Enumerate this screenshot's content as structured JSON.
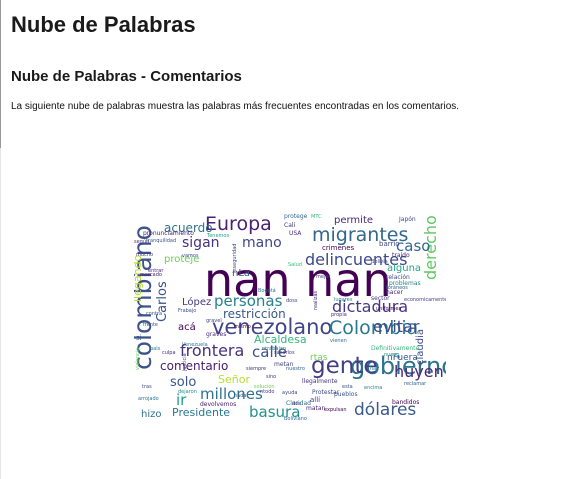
{
  "page": {
    "title": "Nube de Palabras",
    "section_title": "Nube de Palabras - Comentarios",
    "description": "La siguiente nube de palabras muestra las palabras más frecuentes encontradas en los comentarios."
  },
  "wordcloud": {
    "words": [
      {
        "text": "nan nan",
        "color": "#440154"
      },
      {
        "text": "colombiano",
        "color": "#3b528b"
      },
      {
        "text": "gobierno",
        "color": "#2c728e"
      },
      {
        "text": "venezolano",
        "color": "#414487"
      },
      {
        "text": "gente",
        "color": "#433e85"
      },
      {
        "text": "Europa",
        "color": "#482173"
      },
      {
        "text": "migrantes",
        "color": "#31688e"
      },
      {
        "text": "Colombia",
        "color": "#2a788e"
      },
      {
        "text": "delincuentes",
        "color": "#3e4989"
      },
      {
        "text": "frontera",
        "color": "#46327e"
      },
      {
        "text": "dictadura",
        "color": "#443983"
      },
      {
        "text": "derecho",
        "color": "#5ec962"
      },
      {
        "text": "dólares",
        "color": "#38598c"
      },
      {
        "text": "personas",
        "color": "#26828e"
      },
      {
        "text": "huyen",
        "color": "#482878"
      },
      {
        "text": "calle",
        "color": "#3b528b"
      },
      {
        "text": "millones",
        "color": "#2c728e"
      },
      {
        "text": "basura",
        "color": "#21918c"
      },
      {
        "text": "evitar",
        "color": "#3e4989"
      },
      {
        "text": "caso",
        "color": "#31688e"
      },
      {
        "text": "sigan",
        "color": "#46327e"
      },
      {
        "text": "mano",
        "color": "#404688"
      },
      {
        "text": "comentario",
        "color": "#481a6c"
      },
      {
        "text": "solo",
        "color": "#39568c"
      },
      {
        "text": "Presidente",
        "color": "#2a788e"
      },
      {
        "text": "restricción",
        "color": "#38598c"
      },
      {
        "text": "Carlos",
        "color": "#3b528b"
      },
      {
        "text": "acuerdo",
        "color": "#2c728e"
      },
      {
        "text": "llegando",
        "color": "#b5de2b"
      },
      {
        "text": "Señor",
        "color": "#b5de2b"
      },
      {
        "text": "Alcaldesa",
        "color": "#35b779"
      },
      {
        "text": "permite",
        "color": "#482878"
      },
      {
        "text": "alguna",
        "color": "#21a685"
      },
      {
        "text": "claudia",
        "color": "#3e4989"
      },
      {
        "text": "López",
        "color": "#453781"
      },
      {
        "text": "proteje",
        "color": "#6ece58"
      },
      {
        "text": "ir",
        "color": "#1f9e89"
      },
      {
        "text": "hizo",
        "color": "#2c728e"
      },
      {
        "text": "acá",
        "color": "#440154"
      },
      {
        "text": "nLa",
        "color": "#39568c"
      },
      {
        "text": "nFuera",
        "color": "#39568c"
      },
      {
        "text": "crimenes",
        "color": "#440154"
      },
      {
        "text": "barrio",
        "color": "#404688"
      },
      {
        "text": "traído",
        "color": "#482173"
      },
      {
        "text": "relación",
        "color": "#3e4989"
      },
      {
        "text": "problemas",
        "color": "#26828e"
      },
      {
        "text": "hacer",
        "color": "#482878"
      },
      {
        "text": "sector",
        "color": "#453781"
      },
      {
        "text": "bandidos",
        "color": "#440154"
      },
      {
        "text": "Japón",
        "color": "#404688"
      },
      {
        "text": "pronunciamiento",
        "color": "#482173"
      },
      {
        "text": "tranquilidad",
        "color": "#3b528b"
      },
      {
        "text": "protege",
        "color": "#31688e"
      },
      {
        "text": "Cali",
        "color": "#46327e"
      },
      {
        "text": "USA",
        "color": "#482878"
      },
      {
        "text": "Bogotá",
        "color": "#2a788e"
      },
      {
        "text": "mejor",
        "color": "#404688"
      },
      {
        "text": "pueblos",
        "color": "#3b528b"
      },
      {
        "text": "metan",
        "color": "#414487"
      },
      {
        "text": "devolvemos",
        "color": "#482173"
      },
      {
        "text": "llegalmente",
        "color": "#46327e"
      },
      {
        "text": "Claridad",
        "color": "#2c728e"
      },
      {
        "text": "matan",
        "color": "#482878"
      },
      {
        "text": "Protestar",
        "color": "#3e4989"
      },
      {
        "text": "Definitivamente",
        "color": "#35b779"
      },
      {
        "text": "encima",
        "color": "#26828e"
      },
      {
        "text": "esta",
        "color": "#3b528b"
      },
      {
        "text": "solución",
        "color": "#6ece58"
      },
      {
        "text": "graves",
        "color": "#482878"
      },
      {
        "text": "reclamar",
        "color": "#31688e"
      },
      {
        "text": "nuevo",
        "color": "#21918c"
      },
      {
        "text": "ntodo",
        "color": "#453781"
      },
      {
        "text": "allí",
        "color": "#433e85"
      },
      {
        "text": "doss",
        "color": "#404688"
      },
      {
        "text": "frente",
        "color": "#39568c"
      },
      {
        "text": "Venezuela",
        "color": "#2a788e"
      },
      {
        "text": "lugares",
        "color": "#26828e"
      },
      {
        "text": "Salud",
        "color": "#35b779"
      },
      {
        "text": "mercado",
        "color": "#482173"
      },
      {
        "text": "Tenemos",
        "color": "#1f9e89"
      },
      {
        "text": "contra",
        "color": "#3b528b"
      },
      {
        "text": "según",
        "color": "#46327e"
      },
      {
        "text": "realizas",
        "color": "#482878"
      },
      {
        "text": "justicia",
        "color": "#414487"
      },
      {
        "text": "ntrabajan",
        "color": "#2c728e"
      },
      {
        "text": "violencia",
        "color": "#6ece58"
      },
      {
        "text": "expulsan",
        "color": "#440154"
      },
      {
        "text": "foráneos",
        "color": "#31688e"
      },
      {
        "text": "economicamente",
        "color": "#404688"
      },
      {
        "text": "inseguridad",
        "color": "#3e4989"
      },
      {
        "text": "Frabajo",
        "color": "#3b528b"
      },
      {
        "text": "uniformes",
        "color": "#440154"
      },
      {
        "text": "mucho",
        "color": "#46327e"
      },
      {
        "text": "pais",
        "color": "#2a788e"
      },
      {
        "text": "culpa",
        "color": "#482878"
      },
      {
        "text": "tras",
        "color": "#3e4989"
      },
      {
        "text": "dejaron",
        "color": "#21918c"
      },
      {
        "text": "sacarlos",
        "color": "#433e85"
      },
      {
        "text": "vienen",
        "color": "#2c728e"
      },
      {
        "text": "siempre",
        "color": "#453781"
      },
      {
        "text": "nuestro",
        "color": "#31688e"
      },
      {
        "text": "ayuda",
        "color": "#404688"
      },
      {
        "text": "sino",
        "color": "#46327e"
      },
      {
        "text": "nada",
        "color": "#39568c"
      },
      {
        "text": "hay",
        "color": "#26828e"
      },
      {
        "text": "entrar",
        "color": "#482173"
      },
      {
        "text": "vamos",
        "color": "#3b528b"
      },
      {
        "text": "MTC",
        "color": "#35b779"
      },
      {
        "text": "arrojado",
        "color": "#2c728e"
      },
      {
        "text": "Bolivia",
        "color": "#3e4989"
      },
      {
        "text": "propia",
        "color": "#482878"
      },
      {
        "text": "gravel",
        "color": "#404688"
      },
      {
        "text": "dos",
        "color": "#46327e"
      },
      {
        "text": "rtas",
        "color": "#6ece58"
      },
      {
        "text": "Boliviano",
        "color": "#31688e"
      },
      {
        "text": "mismo",
        "color": "#440154"
      },
      {
        "text": "si",
        "color": "#3b528b"
      }
    ]
  }
}
